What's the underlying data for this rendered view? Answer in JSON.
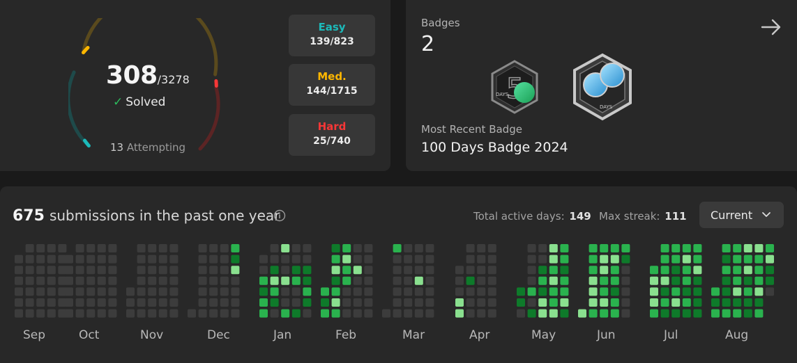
{
  "progress": {
    "solved": "308",
    "total": "/3278",
    "solved_label": "Solved",
    "attempting_count": "13",
    "attempting_label": "Attempting",
    "difficulties": [
      {
        "name": "Easy",
        "value": "139/823",
        "color": "#1cbaba"
      },
      {
        "name": "Med.",
        "value": "144/1715",
        "color": "#ffb700"
      },
      {
        "name": "Hard",
        "value": "25/740",
        "color": "#f63737"
      }
    ]
  },
  "badges": {
    "title": "Badges",
    "count": "2",
    "recent_title": "Most Recent Badge",
    "recent_name": "100 Days Badge 2024",
    "badge_icons": [
      "50-days-badge-icon",
      "100-days-badge-icon"
    ],
    "badge_caption": "DAYS"
  },
  "activity": {
    "count": "675",
    "text": "submissions in the past one year",
    "active_days_label": "Total active days:",
    "active_days": "149",
    "max_streak_label": "Max streak:",
    "max_streak": "111",
    "range_select": "Current",
    "months": [
      "Sep",
      "Oct",
      "Nov",
      "Dec",
      "Jan",
      "Feb",
      "Mar",
      "Apr",
      "May",
      "Jun",
      "Jul",
      "Aug"
    ],
    "level_colors": [
      "#3c3c3c",
      "#0e7a2a",
      "#2ab24e",
      "#8ae08f"
    ]
  }
}
